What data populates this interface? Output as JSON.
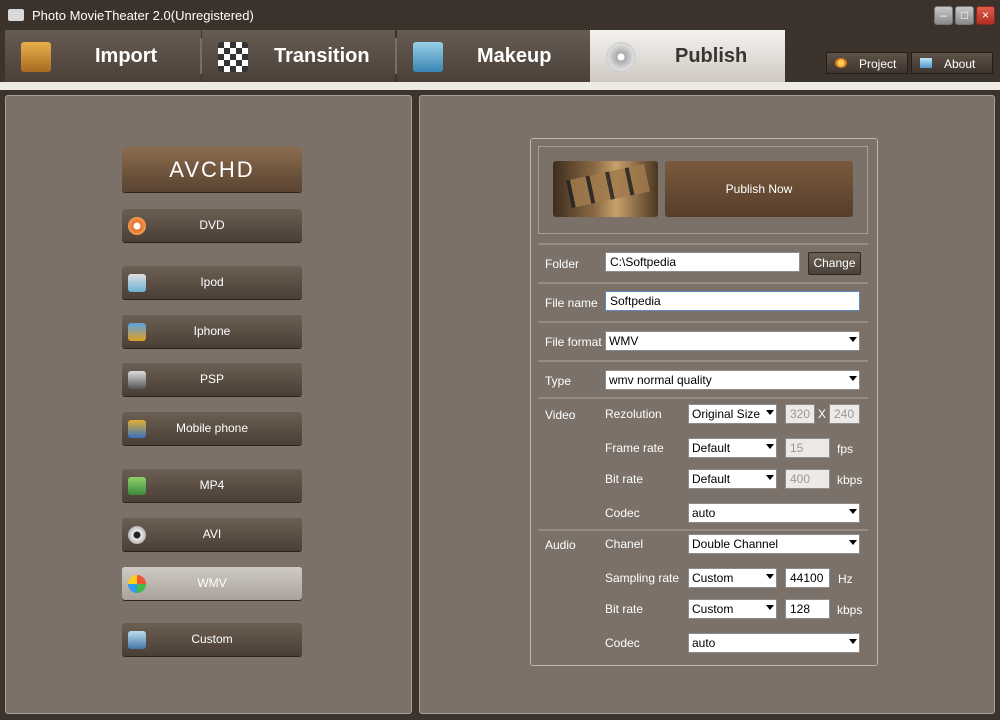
{
  "window": {
    "title": "Photo MovieTheater 2.0(Unregistered)",
    "min_icon": "minimize-icon",
    "max_icon": "maximize-icon",
    "close_icon": "close-icon"
  },
  "tabs": [
    {
      "label": "Import",
      "icon": "import-icon"
    },
    {
      "label": "Transition",
      "icon": "transition-icon"
    },
    {
      "label": "Makeup",
      "icon": "makeup-icon"
    },
    {
      "label": "Publish",
      "icon": "disc-icon",
      "active": true
    }
  ],
  "header_buttons": {
    "project": "Project",
    "about": "About"
  },
  "formats": [
    {
      "label": "AVCHD"
    },
    {
      "label": "DVD"
    },
    {
      "label": "Ipod"
    },
    {
      "label": "Iphone"
    },
    {
      "label": "PSP"
    },
    {
      "label": "Mobile phone"
    },
    {
      "label": "MP4"
    },
    {
      "label": "AVI"
    },
    {
      "label": "WMV",
      "active": true
    },
    {
      "label": "Custom"
    }
  ],
  "publish": {
    "button": "Publish Now"
  },
  "folder": {
    "label": "Folder",
    "value": "C:\\Softpedia",
    "change": "Change"
  },
  "filename": {
    "label": "File name",
    "value": "Softpedia"
  },
  "fileformat": {
    "label": "File format",
    "value": "WMV"
  },
  "type": {
    "label": "Type",
    "value": "wmv normal quality"
  },
  "video": {
    "label": "Video",
    "resolution": {
      "label": "Rezolution",
      "value": "Original Size",
      "w": "320",
      "x": "X",
      "h": "240"
    },
    "framerate": {
      "label": "Frame rate",
      "value": "Default",
      "num": "15",
      "unit": "fps"
    },
    "bitrate": {
      "label": "Bit rate",
      "value": "Default",
      "num": "400",
      "unit": "kbps"
    },
    "codec": {
      "label": "Codec",
      "value": "auto"
    }
  },
  "audio": {
    "label": "Audio",
    "channel": {
      "label": "Chanel",
      "value": "Double Channel"
    },
    "sampling": {
      "label": "Sampling rate",
      "value": "Custom",
      "num": "44100",
      "unit": "Hz"
    },
    "bitrate": {
      "label": "Bit rate",
      "value": "Custom",
      "num": "128",
      "unit": "kbps"
    },
    "codec": {
      "label": "Codec",
      "value": "auto"
    }
  }
}
